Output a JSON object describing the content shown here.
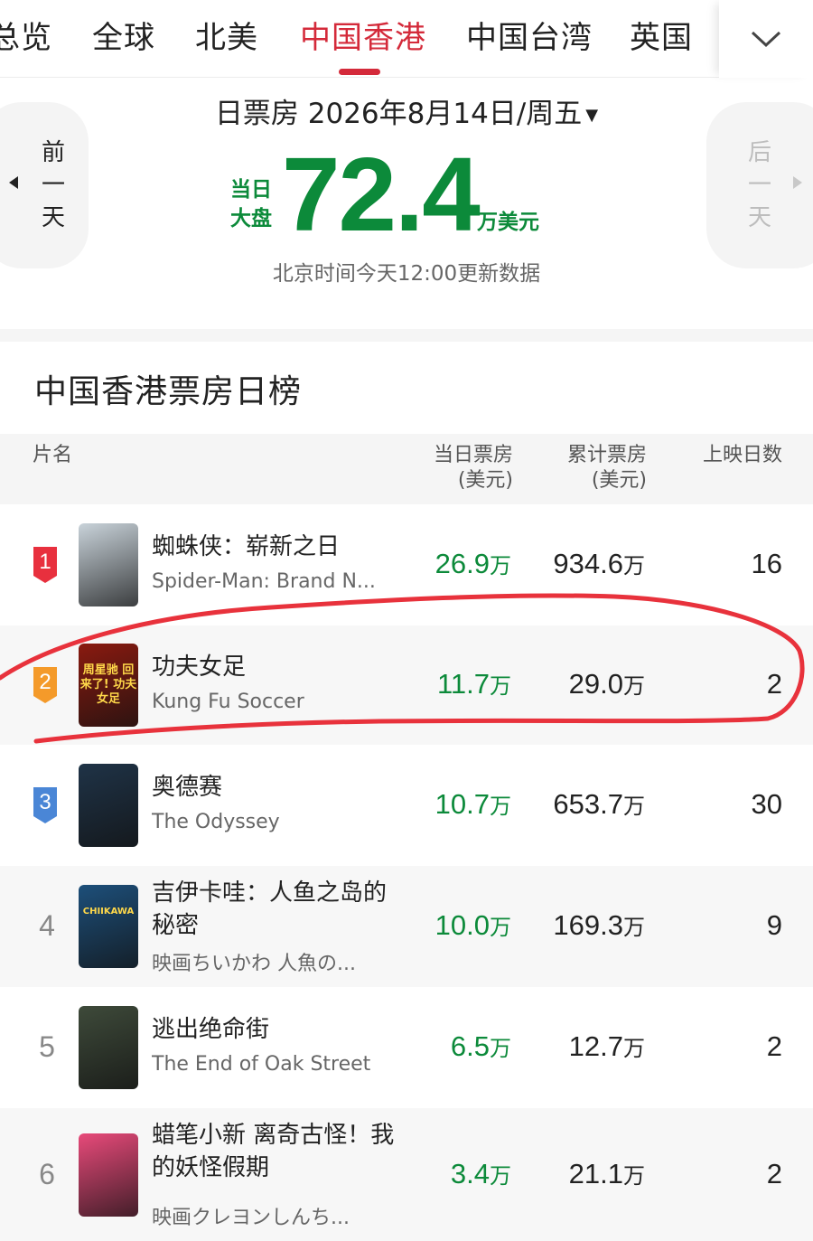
{
  "tabs": [
    {
      "label": "总览",
      "active": false
    },
    {
      "label": "全球",
      "active": false
    },
    {
      "label": "北美",
      "active": false
    },
    {
      "label": "中国香港",
      "active": true
    },
    {
      "label": "中国台湾",
      "active": false
    },
    {
      "label": "英国",
      "active": false
    }
  ],
  "header": {
    "date_prefix": "日票房",
    "date": "2026年8月14日/周五",
    "date_arrow": "▼",
    "prev_day": {
      "l1": "前",
      "l2": "一",
      "l3": "天"
    },
    "next_day": {
      "l1": "后",
      "l2": "一",
      "l3": "天"
    },
    "market_label_1": "当日",
    "market_label_2": "大盘",
    "market_value": "72.4",
    "market_unit": "万美元",
    "update_note": "北京时间今天12:00更新数据"
  },
  "ranking": {
    "title": "中国香港票房日榜",
    "columns": {
      "name": "片名",
      "daily_1": "当日票房",
      "daily_2": "(美元)",
      "total_1": "累计票房",
      "total_2": "(美元)",
      "days": "上映日数"
    },
    "unit_suffix": "万",
    "rows": [
      {
        "rank": "1",
        "title_cn": "蜘蛛侠：崭新之日",
        "title_en": "Spider-Man: Brand N...",
        "daily": "26.9",
        "total": "934.6",
        "days": "16",
        "badge_color": "#e8303e",
        "poster_bg": "#c9d3da",
        "poster_text": ""
      },
      {
        "rank": "2",
        "title_cn": "功夫女足",
        "title_en": "Kung Fu Soccer",
        "daily": "11.7",
        "total": "29.0",
        "days": "2",
        "badge_color": "#f49a2a",
        "poster_bg": "#8a1a10",
        "poster_text": "周星驰 回来了! 功夫女足"
      },
      {
        "rank": "3",
        "title_cn": "奥德赛",
        "title_en": "The Odyssey",
        "daily": "10.7",
        "total": "653.7",
        "days": "30",
        "badge_color": "#4a86d6",
        "poster_bg": "#1f3347",
        "poster_text": ""
      },
      {
        "rank": "4",
        "title_cn": "吉伊卡哇：人鱼之岛的秘密",
        "title_en": "映画ちいかわ 人魚の...",
        "daily": "10.0",
        "total": "169.3",
        "days": "9",
        "badge_color": "",
        "poster_bg": "#1d4f7a",
        "poster_text": "CHIIKAWA"
      },
      {
        "rank": "5",
        "title_cn": "逃出绝命街",
        "title_en": "The End of Oak Street",
        "daily": "6.5",
        "total": "12.7",
        "days": "2",
        "badge_color": "",
        "poster_bg": "#3e4a3a",
        "poster_text": ""
      },
      {
        "rank": "6",
        "title_cn": "蜡笔小新 离奇古怪！我的妖怪假期",
        "title_en": "映画クレヨンしんち...",
        "daily": "3.4",
        "total": "21.1",
        "days": "2",
        "badge_color": "",
        "poster_bg": "#e84a7a",
        "poster_text": ""
      }
    ]
  },
  "colors": {
    "accent_red": "#d42a3a",
    "green": "#0c8a3a",
    "annotation_red": "#e8323c"
  },
  "icons": {
    "more": "chevron-down-icon",
    "prev": "triangle-left-icon",
    "next": "triangle-right-icon"
  }
}
